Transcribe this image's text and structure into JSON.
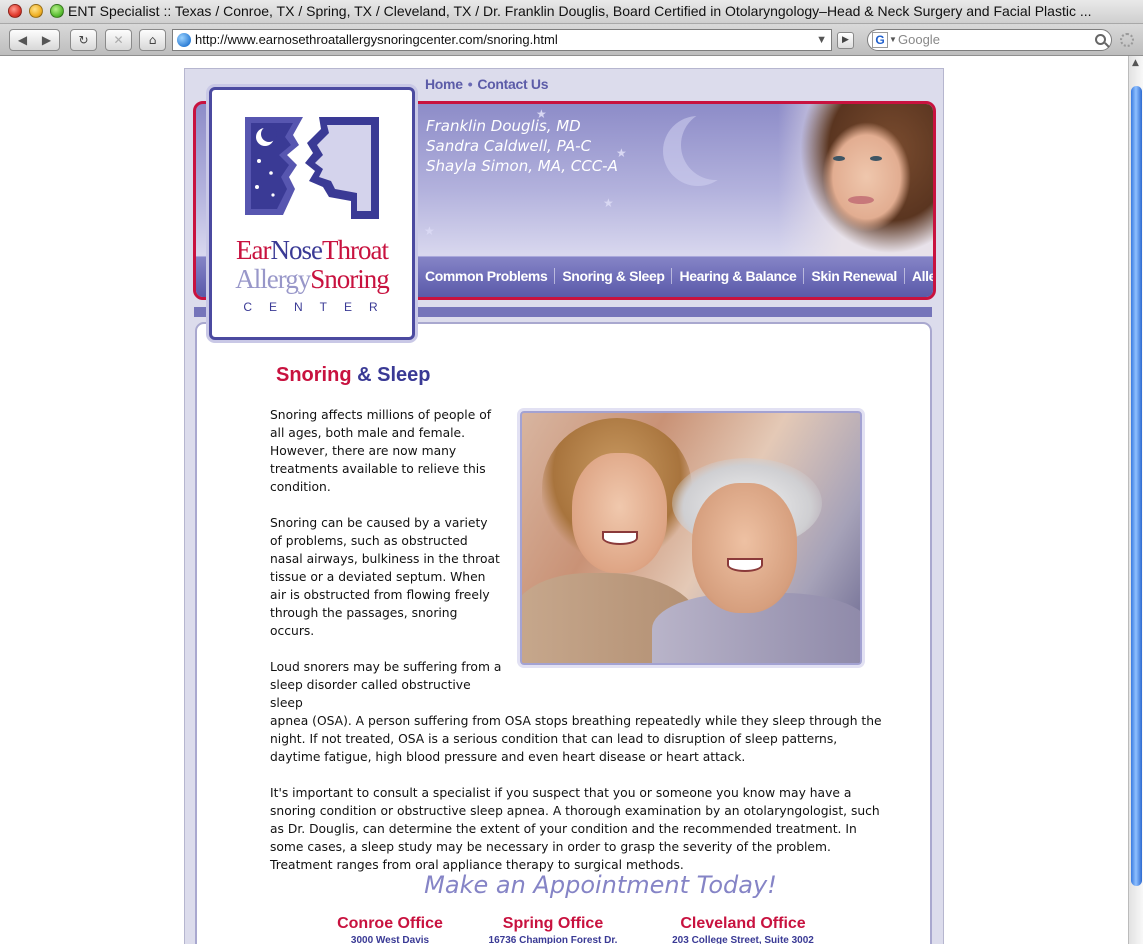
{
  "browser": {
    "window_title": "ENT Specialist :: Texas / Conroe, TX / Spring, TX / Cleveland, TX / Dr. Franklin Douglis, Board Certified in Otolaryngology–Head & Neck Surgery and Facial Plastic ...",
    "url": "http://www.earnosethroatallergysnoringcenter.com/snoring.html",
    "search_placeholder": "Google",
    "back_icon": "◀",
    "forward_icon": "▶",
    "reload_icon": "↻",
    "stop_icon": "✕",
    "home_icon": "⌂",
    "url_dropdown_icon": "▼",
    "snapback_icon": "▶",
    "search_engine_icon": "G",
    "search_dropdown_icon": "▼",
    "scroll_up_icon": "▲"
  },
  "topnav": {
    "home": "Home",
    "separator": "•",
    "contact": "Contact Us"
  },
  "banner": {
    "doctors": [
      "Franklin Douglis, MD",
      "Sandra Caldwell, PA-C",
      "Shayla Simon, MA, CCC-A"
    ],
    "star_glyph": "★"
  },
  "mainnav": [
    "Common Problems",
    "Snoring & Sleep",
    "Hearing & Balance",
    "Skin Renewal",
    "Allergy & Sinus"
  ],
  "logo": {
    "ear": "Ear",
    "nose": "Nose",
    "throat": "Throat",
    "allergy": "Allergy",
    "snoring": "Snoring",
    "center": "CENTER"
  },
  "content": {
    "title_part1": "Snoring",
    "title_part2": " & Sleep",
    "paragraphs": [
      "Snoring affects millions of people of all ages, both male and female. However, there are now many treatments available to relieve this condition.",
      "Snoring can be caused by a variety of problems, such as obstructed nasal airways, bulkiness in the throat tissue or a deviated septum. When air is obstructed from flowing freely through the passages, snoring occurs.",
      "Loud snorers may be suffering from a sleep disorder called obstructive sleep",
      "apnea (OSA). A person suffering from OSA stops breathing repeatedly while they sleep through the night. If not treated, OSA is a serious condition that can lead to disruption of sleep patterns, daytime fatigue, high blood pressure and even heart disease or heart attack.",
      "It's important to consult a specialist if you suspect that you or someone you know may have a snoring condition or obstructive sleep apnea. A thorough examination by an otolaryngologist, such as Dr. Douglis, can determine the extent of your condition and the recommended treatment. In some cases, a sleep study may be necessary in order to grasp the severity of the problem. Treatment ranges from oral appliance therapy to surgical methods."
    ],
    "appointment_heading": "Make an Appointment Today!",
    "offices": [
      {
        "name": "Conroe Office",
        "address": "3000 West Davis"
      },
      {
        "name": "Spring Office",
        "address": "16736 Champion Forest Dr."
      },
      {
        "name": "Cleveland Office",
        "address": "203 College Street, Suite 3002"
      }
    ]
  },
  "colors": {
    "brand_red": "#c8123f",
    "brand_navy": "#3a3a95",
    "brand_lavender": "#8584c6"
  }
}
